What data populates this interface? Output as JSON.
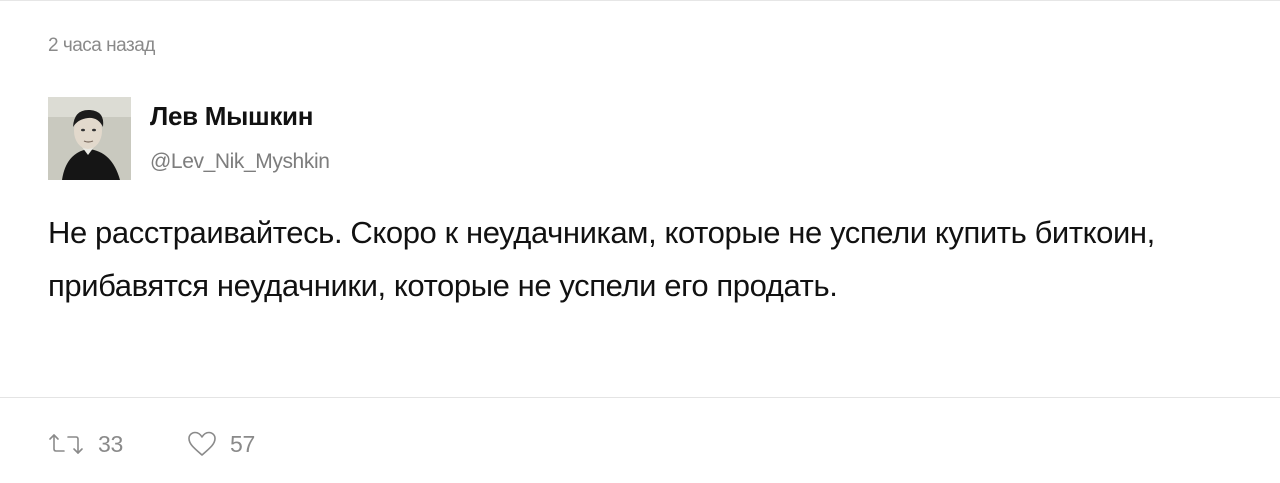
{
  "tweet": {
    "timestamp": "2 часа назад",
    "author": {
      "name": "Лев Мышкин",
      "handle": "@Lev_Nik_Myshkin",
      "avatar_icon": "user-photo"
    },
    "text": "Не расстраивайтесь. Скоро к неудачникам, которые не успели купить биткоин, прибавятся неудачники, которые не успели его продать.",
    "actions": {
      "retweet": {
        "icon": "retweet-icon",
        "count": "33"
      },
      "like": {
        "icon": "heart-icon",
        "count": "57"
      }
    }
  },
  "colors": {
    "text": "#111111",
    "muted": "#8a8a8a",
    "divider": "#e4e4e4"
  }
}
